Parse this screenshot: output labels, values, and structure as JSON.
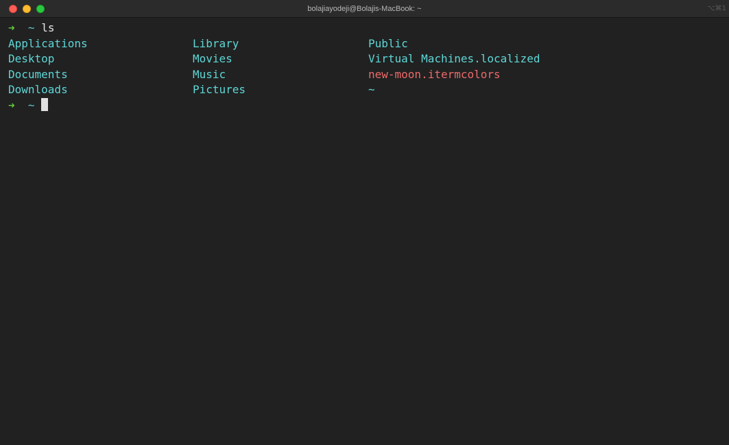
{
  "window": {
    "title": "bolajiayodeji@Bolajis-MacBook: ~",
    "shortcut": "⌥⌘1"
  },
  "colors": {
    "prompt_arrow": "#64c83c",
    "directory": "#5fd7d7",
    "file": "#ee6a6a",
    "background": "#212121"
  },
  "terminal": {
    "prompt1": {
      "arrow": "➜",
      "path": "~",
      "command": "ls"
    },
    "ls_output": {
      "col0": [
        "Applications",
        "Desktop",
        "Documents",
        "Downloads"
      ],
      "col1": [
        "Library",
        "Movies",
        "Music",
        "Pictures"
      ],
      "col2": [
        "Public",
        "Virtual Machines.localized",
        "new-moon.itermcolors",
        "~"
      ]
    },
    "prompt2": {
      "arrow": "➜",
      "path": "~"
    }
  }
}
